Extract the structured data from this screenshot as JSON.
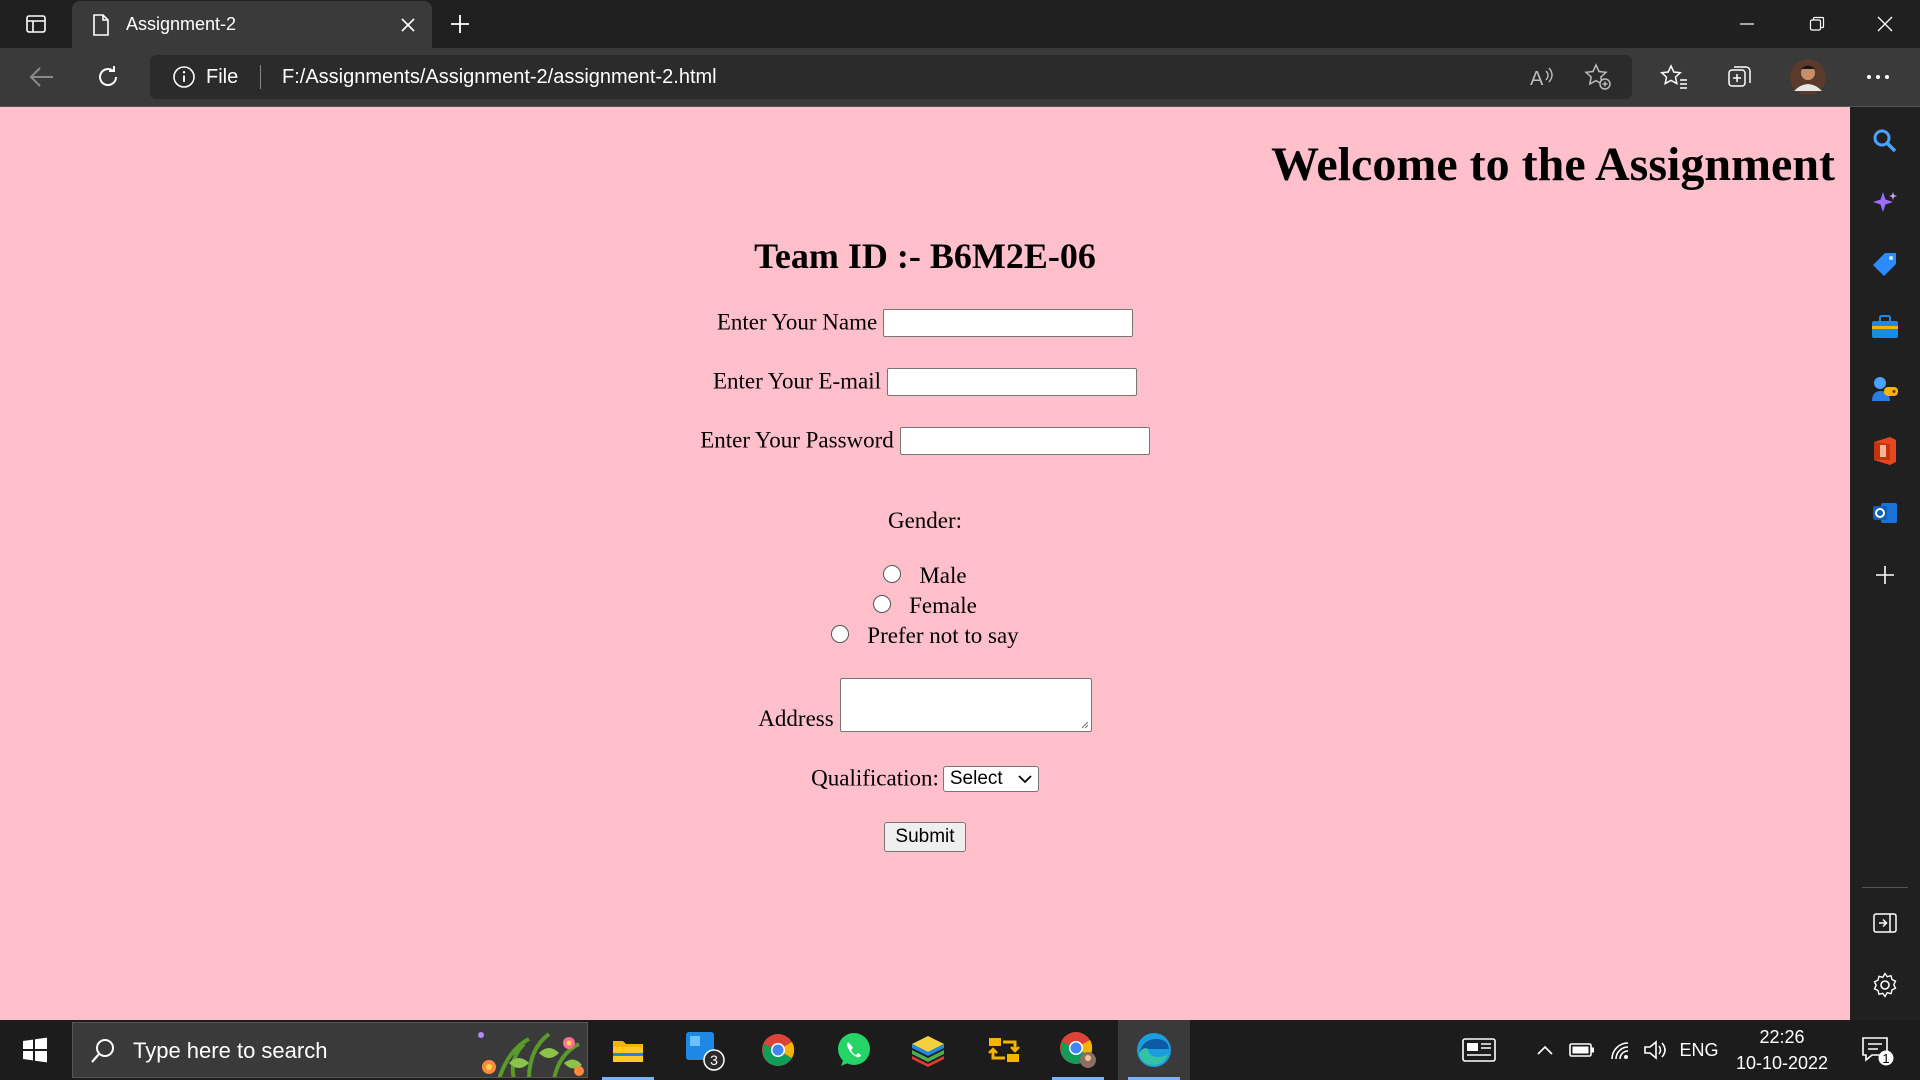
{
  "browser": {
    "tab_title": "Assignment-2",
    "site_info_label": "File",
    "url": "F:/Assignments/Assignment-2/assignment-2.html"
  },
  "page": {
    "welcome_heading": "Welcome to the Assignment",
    "team_heading": "Team ID :- B6M2E-06",
    "name_label": "Enter Your Name",
    "email_label": "Enter Your E-mail",
    "password_label": "Enter Your Password",
    "gender_label": "Gender:",
    "gender_options": [
      "Male",
      "Female",
      "Prefer not to say"
    ],
    "address_label": "Address",
    "qualification_label": "Qualification:",
    "qualification_selected": "Select",
    "submit_label": "Submit"
  },
  "taskbar": {
    "search_placeholder": "Type here to search",
    "store_badge": "3",
    "language": "ENG",
    "time": "22:26",
    "date": "10-10-2022",
    "notification_count": "1"
  }
}
